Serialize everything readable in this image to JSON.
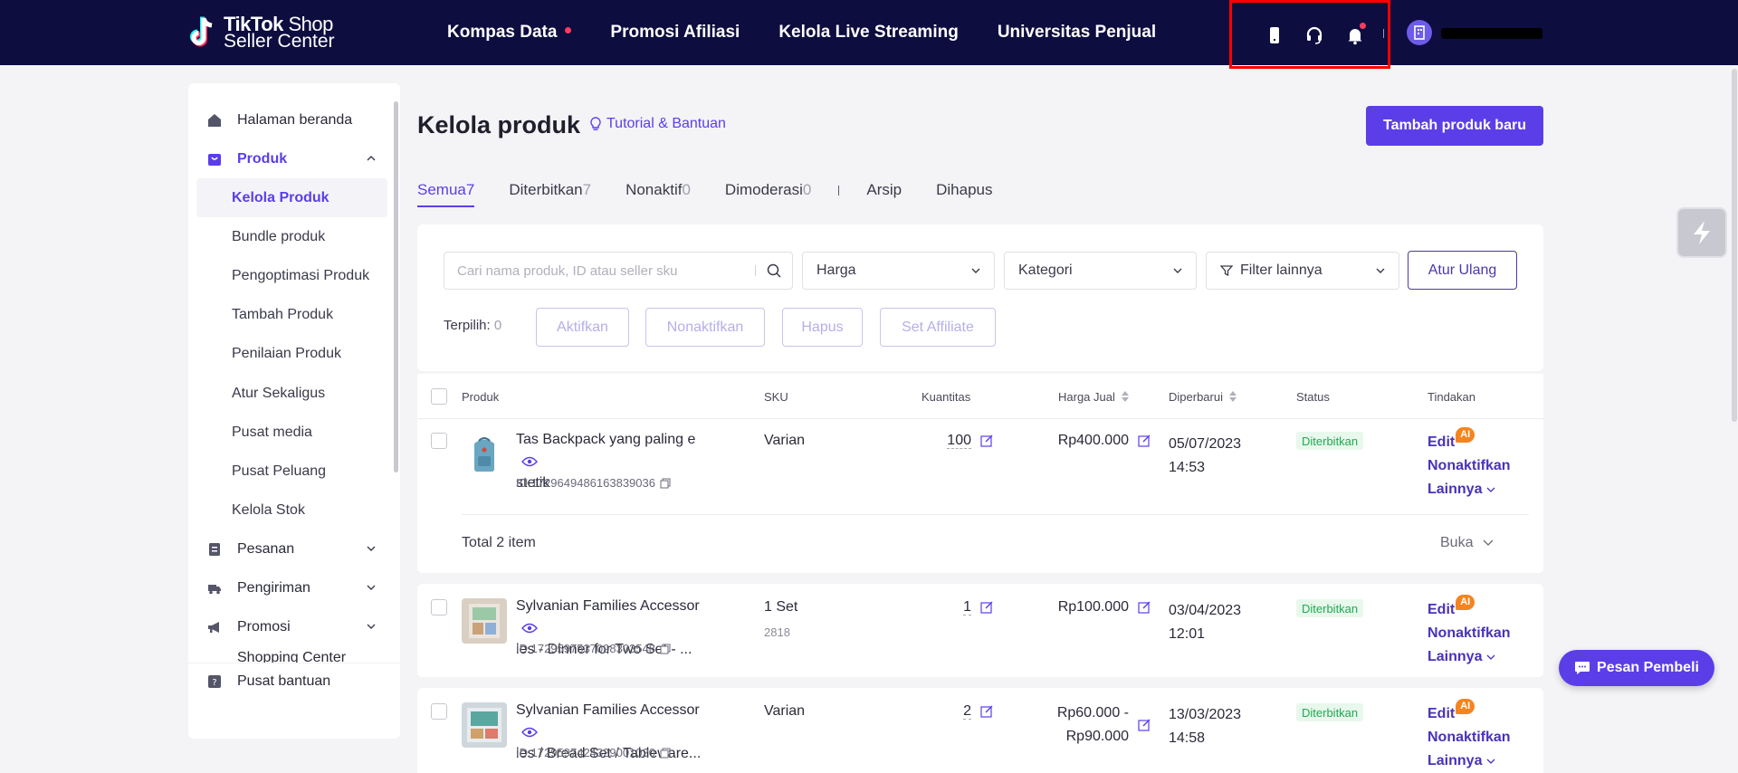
{
  "brand": {
    "line1_bold": "TikTok",
    "line1_rest": " Shop",
    "line2": "Seller Center"
  },
  "nav": {
    "links": [
      "Kompas Data",
      "Promosi Afiliasi",
      "Kelola Live Streaming",
      "Universitas Penjual"
    ],
    "icons": [
      "mobile-icon",
      "headset-icon",
      "bell-icon"
    ]
  },
  "sidebar": {
    "home": "Halaman beranda",
    "produk": "Produk",
    "produk_sub": [
      "Kelola Produk",
      "Bundle produk",
      "Pengoptimasi Produk",
      "Tambah Produk",
      "Penilaian Produk",
      "Atur Sekaligus",
      "Pusat media",
      "Pusat Peluang",
      "Kelola Stok"
    ],
    "pesanan": "Pesanan",
    "pengiriman": "Pengiriman",
    "promosi": "Promosi",
    "cut_item": "Shopping Center",
    "help": "Pusat bantuan"
  },
  "page": {
    "title": "Kelola produk",
    "tutorial": "Tutorial & Bantuan",
    "add_button": "Tambah produk baru"
  },
  "tabs": [
    {
      "label": "Semua",
      "count": "7"
    },
    {
      "label": "Diterbitkan",
      "count": "7"
    },
    {
      "label": "Nonaktif",
      "count": "0"
    },
    {
      "label": "Dimoderasi",
      "count": "0"
    },
    {
      "label": "Arsip",
      "count": ""
    },
    {
      "label": "Dihapus",
      "count": ""
    }
  ],
  "filters": {
    "search_placeholder": "Cari nama produk, ID atau seller sku",
    "harga": "Harga",
    "kategori": "Kategori",
    "lainnya": "Filter lainnya",
    "reset": "Atur Ulang",
    "selected_label": "Terpilih:",
    "selected_count": "0",
    "bulk": [
      "Aktifkan",
      "Nonaktifkan",
      "Hapus",
      "Set Affiliate"
    ]
  },
  "table": {
    "headers": {
      "produk": "Produk",
      "sku": "SKU",
      "qty": "Kuantitas",
      "price": "Harga Jual",
      "updated": "Diperbarui",
      "status": "Status",
      "actions": "Tindakan"
    },
    "rows": [
      {
        "name_l1": "Tas Backpack yang paling e",
        "name_l2": "stetik",
        "id": "ID:1729649486163839036",
        "sku": "Varian",
        "sku_sub": "",
        "qty": "100",
        "price_l1": "Rp400.000",
        "price_l2": "",
        "date": "05/07/2023",
        "time": "14:53",
        "status": "Diterbitkan",
        "total": "Total 2 item",
        "expand": "Buka"
      },
      {
        "name_l1": "Sylvanian Families Accessor",
        "name_l2": "ies - Dinner for Two Set - ...",
        "id": "ID:1729597537098303548",
        "sku": "1 Set",
        "sku_sub": "2818",
        "qty": "1",
        "price_l1": "Rp100.000",
        "price_l2": "",
        "date": "03/04/2023",
        "time": "12:01",
        "status": "Diterbitkan"
      },
      {
        "name_l1": "Sylvanian Families Accessor",
        "name_l2": "ies / Bread Set / Tableware...",
        "id": "ID:1729597424329001020",
        "sku": "Varian",
        "sku_sub": "",
        "qty": "2",
        "price_l1": "Rp60.000 -",
        "price_l2": "Rp90.000",
        "date": "13/03/2023",
        "time": "14:58",
        "status": "Diterbitkan"
      }
    ],
    "action_labels": {
      "edit": "Edit",
      "ai": "AI",
      "deactivate": "Nonaktifkan",
      "more": "Lainnya"
    }
  },
  "chat_button": "Pesan Pembeli",
  "colors": {
    "nav_bg": "#0d0d40",
    "accent": "#5b3ee8",
    "status_green": "#1eaa52",
    "ai_orange": "#f5841f"
  }
}
